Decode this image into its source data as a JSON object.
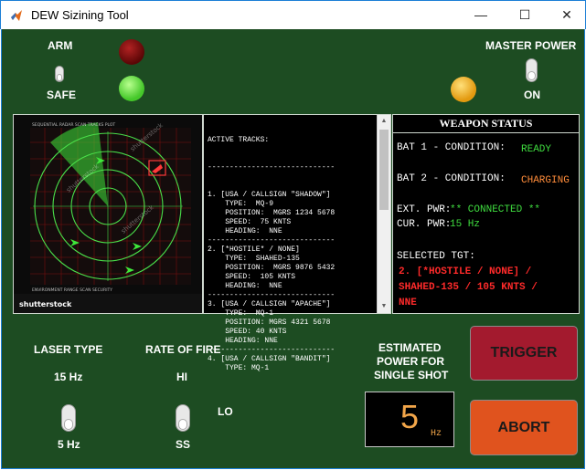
{
  "window": {
    "title": "DEW Sizining Tool",
    "controls": {
      "minimize": "—",
      "maximize": "☐",
      "close": "✕"
    }
  },
  "colors": {
    "background": "#1d4c22",
    "status_ready": "#3fdc3f",
    "status_charging": "#ff8c3a",
    "target_red": "#ff2a2a",
    "trigger_bg": "#a31a2e",
    "abort_bg": "#e0531e",
    "power_digit": "#f2a64a",
    "lamp_red": "#7a0a0a",
    "lamp_green": "#5fe23a",
    "lamp_amber": "#f0a818"
  },
  "arm": {
    "label_top": "ARM",
    "label_bottom": "SAFE",
    "toggle_position": "down"
  },
  "master_power": {
    "label": "MASTER POWER",
    "state_label": "ON",
    "toggle_position": "down"
  },
  "lamps": [
    "red-lamp-dark",
    "green-lamp-on",
    "amber-lamp-on"
  ],
  "radar": {
    "watermark": "shutterstock",
    "icon": "radar-scope-image"
  },
  "tracks": {
    "header": "ACTIVE TRACKS:",
    "separator": "-----------------------------",
    "lines": [
      "1. [USA / CALLSIGN \"SHADOW\"]",
      "    TYPE:  MQ-9",
      "    POSITION:  MGRS 1234 5678",
      "    SPEED:  75 KNTS",
      "    HEADING:  NNE",
      "-----------------------------",
      "2. [*HOSTILE* / NONE]",
      "    TYPE:  SHAHED-135",
      "    POSITION:  MGRS 9876 5432",
      "    SPEED:  105 KNTS",
      "    HEADING:  NNE",
      "-----------------------------",
      "3. [USA / CALLSIGN \"APACHE\"]",
      "    TYPE:  MQ-1",
      "    POSITION: MGRS 4321 5678",
      "    SPEED: 40 KNTS",
      "    HEADING: NNE",
      "-----------------------------",
      "4. [USA / CALLSIGN \"BANDIT\"]",
      "    TYPE: MQ-1"
    ]
  },
  "weapon_status": {
    "title": "WEAPON STATUS",
    "bat1_label": "BAT 1 - CONDITION:",
    "bat1_value": "READY",
    "bat2_label": "BAT 2 - CONDITION:",
    "bat2_value": "CHARGING",
    "ext_label": "EXT. PWR:",
    "ext_value": "** CONNECTED **",
    "cur_label": "CUR. PWR:",
    "cur_value": "15 Hz",
    "selected_label": "SELECTED TGT:",
    "selected_lines": [
      "2. [*HOSTILE / NONE] /",
      "SHAHED-135 / 105 KNTS /",
      "NNE"
    ]
  },
  "laser_type": {
    "label": "LASER TYPE",
    "top_option": "15 Hz",
    "bottom_option": "5 Hz"
  },
  "rate_of_fire": {
    "label": "RATE OF FIRE",
    "top_option": "HI",
    "side_option": "LO",
    "bottom_option": "SS"
  },
  "power_estimate": {
    "label_line1": "ESTIMATED",
    "label_line2": "POWER FOR",
    "label_line3": "SINGLE SHOT",
    "value": "5",
    "unit": "Hz"
  },
  "buttons": {
    "trigger": "TRIGGER",
    "abort": "ABORT"
  }
}
